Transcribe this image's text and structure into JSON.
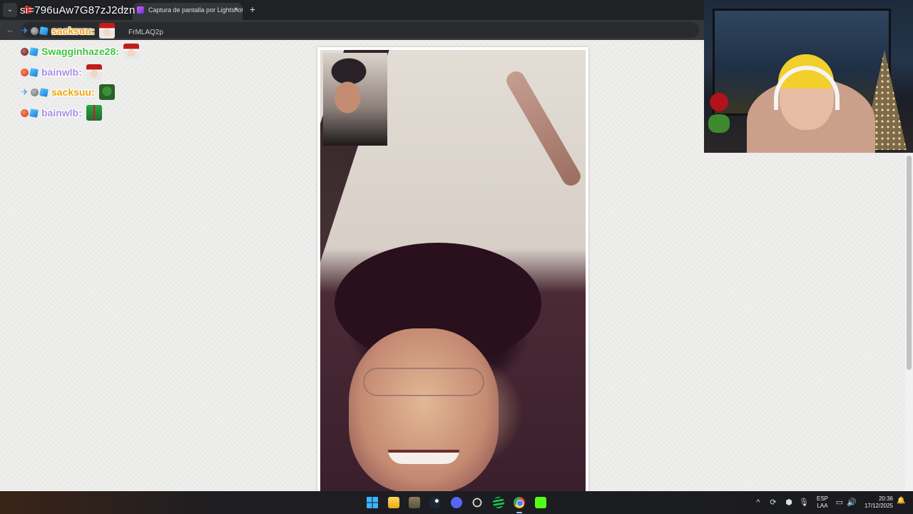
{
  "browser": {
    "tabs": [
      {
        "label": "",
        "active": false
      },
      {
        "label": "Captura de pantalla por Lightshot",
        "active": true
      }
    ],
    "new_tab_label": "+",
    "url_overlay": "si=796uAw7G87zJ2dzn",
    "address_partial": "FrMLAQ2p",
    "back_label": "←"
  },
  "chat": {
    "messages": [
      {
        "user": "sacksuu:",
        "color": "#f0a30a",
        "badges": [
          "pin",
          "gray",
          "cube"
        ],
        "emote": "santa"
      },
      {
        "user": "Swagginhaze28:",
        "color": "#3fc43f",
        "badges": [
          "dark",
          "cube"
        ],
        "emote": "santa"
      },
      {
        "user": "bainwlb:",
        "color": "#a88fe8",
        "badges": [
          "red",
          "cube"
        ],
        "emote": "santa"
      },
      {
        "user": "sacksuu:",
        "color": "#f0a30a",
        "badges": [
          "pin",
          "gray",
          "cube"
        ],
        "emote": "pepe"
      },
      {
        "user": "bainwlb:",
        "color": "#a88fe8",
        "badges": [
          "red",
          "cube"
        ],
        "emote": "gift"
      }
    ]
  },
  "taskbar": {
    "icons": [
      "windows-start",
      "file-explorer",
      "app",
      "steam",
      "discord",
      "obs",
      "spotify",
      "chrome",
      "kick"
    ],
    "tray": {
      "chevron": "^",
      "lang_top": "ESP",
      "lang_bottom": "LAA",
      "time": "20:36",
      "date": "17/12/2025"
    }
  }
}
